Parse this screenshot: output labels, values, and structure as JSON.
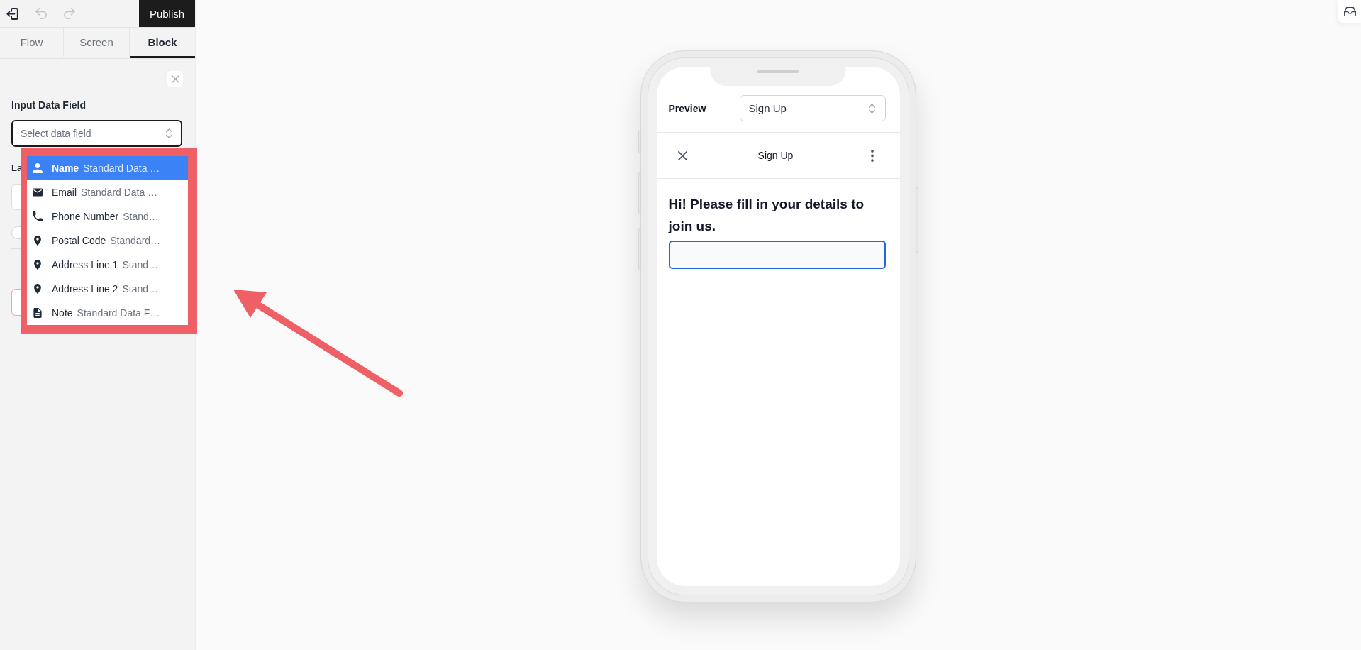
{
  "toolbar": {
    "actions": [
      {
        "kind": "exit",
        "disabled": false
      },
      {
        "kind": "undo",
        "disabled": true
      },
      {
        "kind": "redo",
        "disabled": true
      }
    ],
    "publish": "Publish"
  },
  "tabs": [
    {
      "label": "Flow",
      "selected": false
    },
    {
      "label": "Screen",
      "selected": false
    },
    {
      "label": "Block",
      "selected": true
    }
  ],
  "block_panel": {
    "field_label": "Input Data Field",
    "select": {
      "placeholder": "Select data field",
      "expanded": true
    },
    "next_field_label": "La",
    "toggle": {
      "on": false
    }
  },
  "dropdown": {
    "items": [
      {
        "kind": "person",
        "label": "Name",
        "detail": "Standard Data …",
        "selected": true
      },
      {
        "kind": "email",
        "label": "Email",
        "detail": "Standard Data …",
        "selected": false
      },
      {
        "kind": "phone",
        "label": "Phone Number",
        "detail": "Stand…",
        "selected": false
      },
      {
        "kind": "location",
        "label": "Postal Code",
        "detail": "Standard…",
        "selected": false
      },
      {
        "kind": "location",
        "label": "Address Line 1",
        "detail": "Stand…",
        "selected": false
      },
      {
        "kind": "location",
        "label": "Address Line 2",
        "detail": "Stand…",
        "selected": false
      },
      {
        "kind": "note",
        "label": "Note",
        "detail": "Standard Data F…",
        "selected": false
      }
    ]
  },
  "preview": {
    "label": "Preview",
    "screen_select": "Sign Up",
    "nav_title": "Sign Up",
    "heading": "Hi! Please fill in your details to join us.",
    "input": {
      "focused": true
    }
  }
}
